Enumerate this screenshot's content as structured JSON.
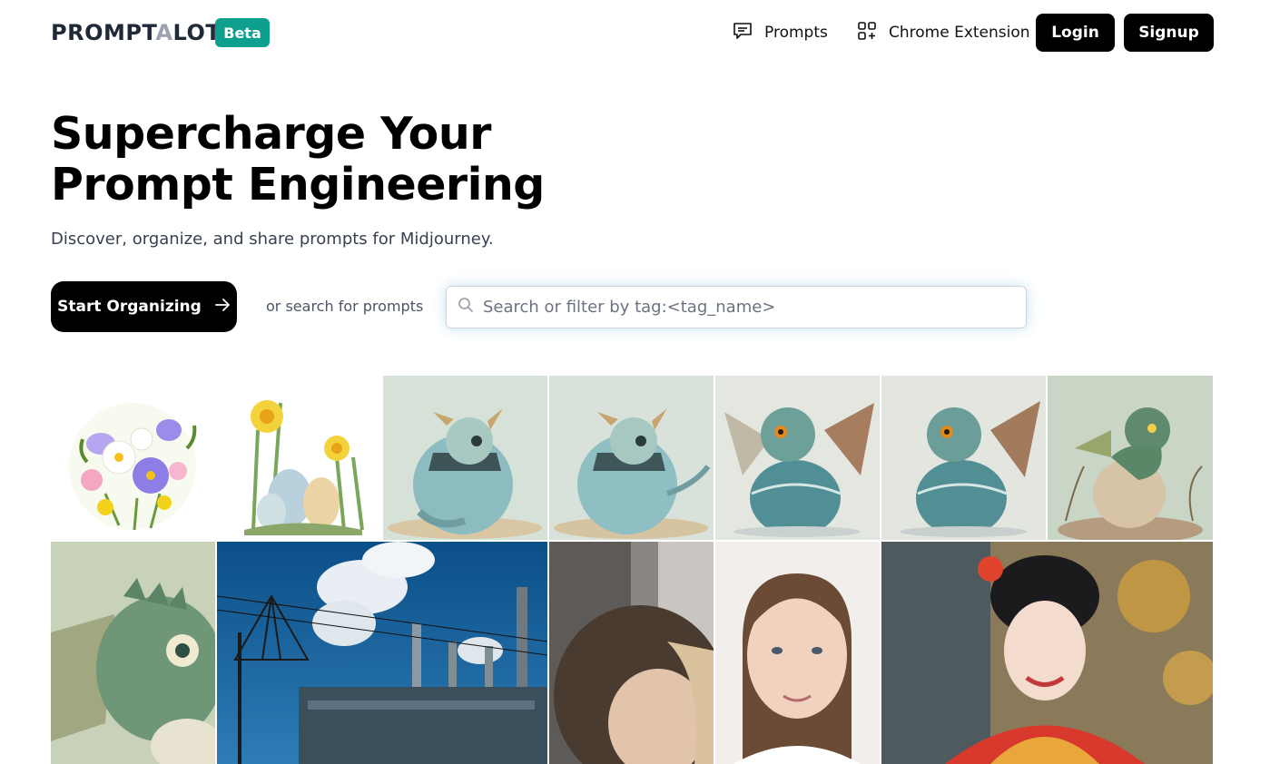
{
  "header": {
    "logo_text": "PROMPTALOT",
    "logo_part1": "PROMPT",
    "logo_part2": "A",
    "logo_part3": "LOT",
    "beta_label": "Beta",
    "nav": {
      "prompts_label": "Prompts",
      "prompts_icon": "chat-bubble-icon",
      "extension_label": "Chrome Extension",
      "extension_icon": "grid-plus-icon"
    },
    "login_label": "Login",
    "signup_label": "Signup"
  },
  "hero": {
    "title_line1": "Supercharge Your",
    "title_line2": "Prompt Engineering",
    "subtitle": "Discover, organize, and share prompts for Midjourney.",
    "cta_label": "Start Organizing",
    "cta_icon": "arrow-right-icon",
    "or_text": "or search for prompts",
    "search_placeholder": "Search or filter by tag:<tag_name>",
    "search_icon": "search-icon"
  },
  "gallery": {
    "items": [
      {
        "subject": "flower-bouquet"
      },
      {
        "subject": "daffodils-easter-eggs"
      },
      {
        "subject": "baby-dragon-egg"
      },
      {
        "subject": "baby-dragon-egg"
      },
      {
        "subject": "baby-dragon-wings"
      },
      {
        "subject": "baby-dragon-wings"
      },
      {
        "subject": "dragon-on-egg"
      },
      {
        "subject": "dragon-closeup"
      },
      {
        "subject": "industrial-plant"
      },
      {
        "subject": "blurred-woman"
      },
      {
        "subject": "woman-portrait"
      },
      {
        "subject": "geisha-portrait"
      }
    ]
  },
  "colors": {
    "accent": "#0f9f8f",
    "button_dark": "#000000",
    "text_muted": "#4b5563"
  }
}
